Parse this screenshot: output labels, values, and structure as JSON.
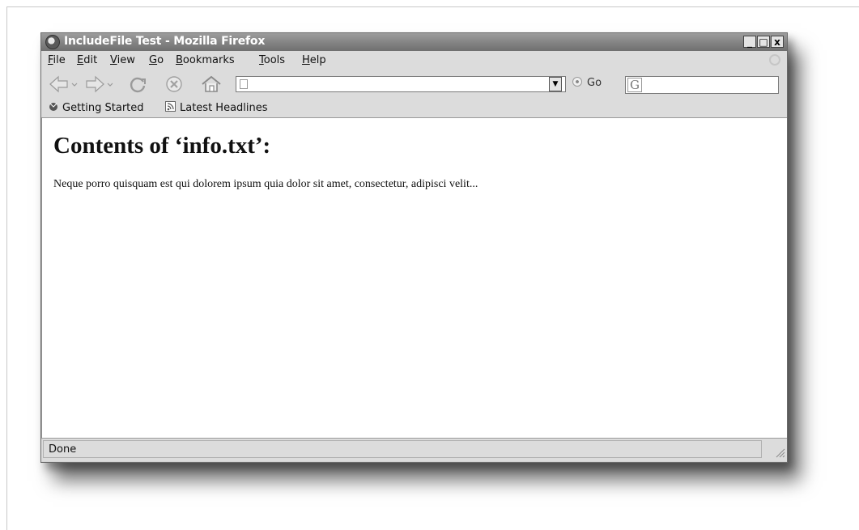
{
  "window": {
    "title": "IncludeFile Test - Mozilla Firefox",
    "controls": {
      "minimize": "_",
      "maximize": "□",
      "close": "x"
    }
  },
  "menu": {
    "items": [
      {
        "label": "File",
        "accel": "F",
        "rest": "ile"
      },
      {
        "label": "Edit",
        "accel": "E",
        "rest": "dit"
      },
      {
        "label": "View",
        "accel": "V",
        "rest": "iew"
      },
      {
        "label": "Go",
        "accel": "G",
        "rest": "o"
      },
      {
        "label": "Bookmarks",
        "accel": "B",
        "rest": "ookmarks"
      },
      {
        "label": "Tools",
        "accel": "T",
        "rest": "ools"
      },
      {
        "label": "Help",
        "accel": "H",
        "rest": "elp"
      }
    ]
  },
  "navigation": {
    "icons": [
      "back-icon",
      "forward-icon",
      "reload-icon",
      "stop-icon",
      "home-icon"
    ],
    "url_value": "",
    "go_label": "Go",
    "search_value": ""
  },
  "bookmarks": {
    "items": [
      {
        "label": "Getting Started",
        "icon": "getting-started-icon"
      },
      {
        "label": "Latest Headlines",
        "icon": "rss-feed-icon"
      }
    ]
  },
  "page": {
    "heading": "Contents of ‘info.txt’:",
    "paragraph": "Neque porro quisquam est qui dolorem ipsum quia dolor sit amet, consectetur, adipisci velit..."
  },
  "status": {
    "text": "Done"
  },
  "colors": {
    "titlebar": "#7f7f7f",
    "chrome": "#dcdcdc",
    "page_bg": "#ffffff"
  }
}
